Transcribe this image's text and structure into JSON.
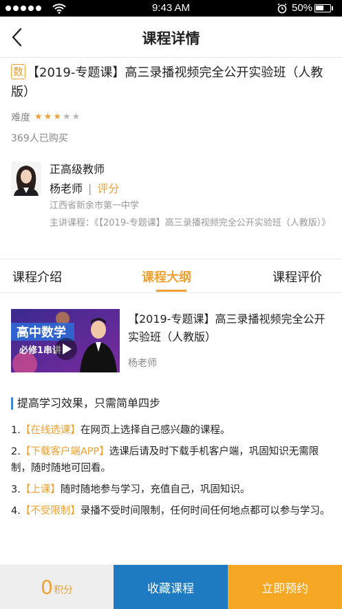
{
  "status_bar": {
    "time": "9:43 AM",
    "battery": "50%",
    "battery_level": 0.5,
    "signal_bars": 5
  },
  "nav": {
    "title": "课程详情"
  },
  "course": {
    "badge": "数",
    "title": "【2019-专题课】高三录播视频完全公开实验班（人教版）",
    "difficulty_label": "难度",
    "difficulty_stars": 3,
    "difficulty_max": 5,
    "buyers": "369人已购买"
  },
  "teacher": {
    "rank": "正高级教师",
    "name": "杨老师",
    "separator": "|",
    "rate_label": "评分",
    "school": "江西省新余市第一中学",
    "main_course": "主讲课程：《【2019-专题课】高三录播视频完全公开实验班（人教版）》"
  },
  "tabs": [
    {
      "label": "课程介绍",
      "active": false
    },
    {
      "label": "课程大纲",
      "active": true
    },
    {
      "label": "课程评价",
      "active": false
    }
  ],
  "lesson": {
    "thumb_title": "高中数学",
    "thumb_subtitle": "必修1串讲",
    "title": "【2019-专题课】高三录播视频完全公开实验班（人教版）",
    "teacher": "杨老师"
  },
  "steps": {
    "title": "提高学习效果，只需简单四步",
    "items": [
      {
        "num": "1.",
        "highlight": "【在线选课】",
        "text": "在网页上选择自己感兴趣的课程。"
      },
      {
        "num": "2.",
        "highlight": "【下载客户端APP】",
        "text": "选课后请及时下载手机客户端，巩固知识无需限制，随时随地可回看。"
      },
      {
        "num": "3.",
        "highlight": "【上课】",
        "text": "随时随地参与学习，充值自己，巩固知识。"
      },
      {
        "num": "4.",
        "highlight": "【不受限制】",
        "text": "录播不受时间限制，任何时间任何地点都可以参与学习。"
      }
    ]
  },
  "bottom": {
    "points": "0",
    "points_unit": "积分",
    "favorite": "收藏课程",
    "book": "立即预约"
  },
  "colors": {
    "accent": "#f0a030",
    "blue": "#1e7bc2",
    "orange_button": "#f5a623"
  }
}
